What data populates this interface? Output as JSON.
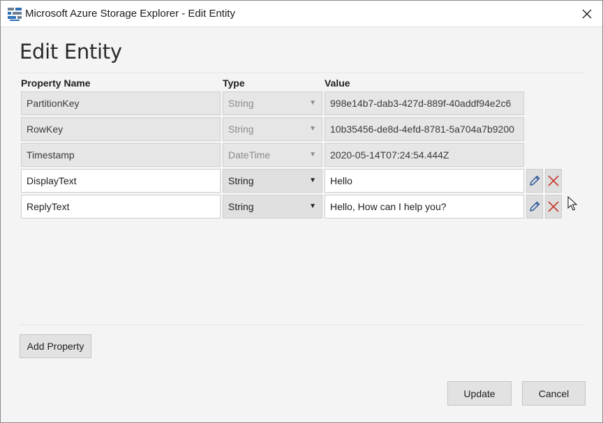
{
  "window": {
    "title": "Microsoft Azure Storage Explorer - Edit Entity",
    "icon": "storage-explorer-icon"
  },
  "dialog": {
    "heading": "Edit Entity",
    "columns": {
      "property_name": "Property Name",
      "type": "Type",
      "value": "Value"
    },
    "rows": [
      {
        "name": "PartitionKey",
        "type": "String",
        "value": "998e14b7-dab3-427d-889f-40addf94e2c6",
        "editable": false
      },
      {
        "name": "RowKey",
        "type": "String",
        "value": "10b35456-de8d-4efd-8781-5a704a7b9200",
        "editable": false
      },
      {
        "name": "Timestamp",
        "type": "DateTime",
        "value": "2020-05-14T07:24:54.444Z",
        "editable": false
      },
      {
        "name": "DisplayText",
        "type": "String",
        "value": "Hello",
        "editable": true
      },
      {
        "name": "ReplyText",
        "type": "String",
        "value": "Hello, How can I help you?",
        "editable": true
      }
    ],
    "add_property_label": "Add Property",
    "update_label": "Update",
    "cancel_label": "Cancel"
  },
  "colors": {
    "edit_icon": "#2b5797",
    "delete_icon": "#c4392c",
    "readonly_bg": "#e6e6e6"
  }
}
